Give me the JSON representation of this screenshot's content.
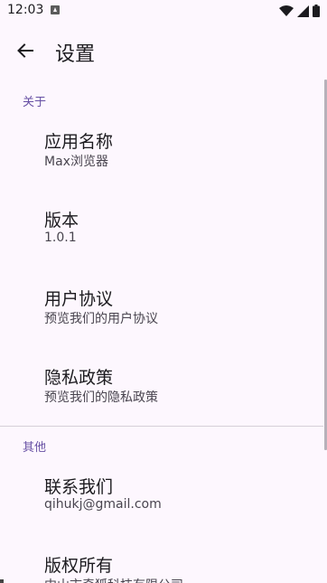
{
  "status_bar": {
    "time": "12:03",
    "icons": [
      "notification-icon",
      "wifi-icon",
      "signal-icon",
      "battery-icon"
    ]
  },
  "app_bar": {
    "back_icon": "arrow-back-icon",
    "title": "设置"
  },
  "sections": [
    {
      "header": "关于",
      "items": [
        {
          "title": "应用名称",
          "summary": "Max浏览器"
        },
        {
          "title": "版本",
          "summary": "1.0.1"
        },
        {
          "title": "用户协议",
          "summary": "预览我们的用户协议"
        },
        {
          "title": "隐私政策",
          "summary": "预览我们的隐私政策"
        }
      ]
    },
    {
      "header": "其他",
      "items": [
        {
          "title": "联系我们",
          "summary": "qihukj@gmail.com"
        },
        {
          "title": "版权所有",
          "summary": "中山市奇狐科技有限公司"
        }
      ]
    }
  ],
  "colors": {
    "background": "#fdf7fe",
    "accent": "#6750a4",
    "text_primary": "#1c1b1f",
    "text_secondary": "#49454f",
    "divider": "#d6d0d8"
  }
}
